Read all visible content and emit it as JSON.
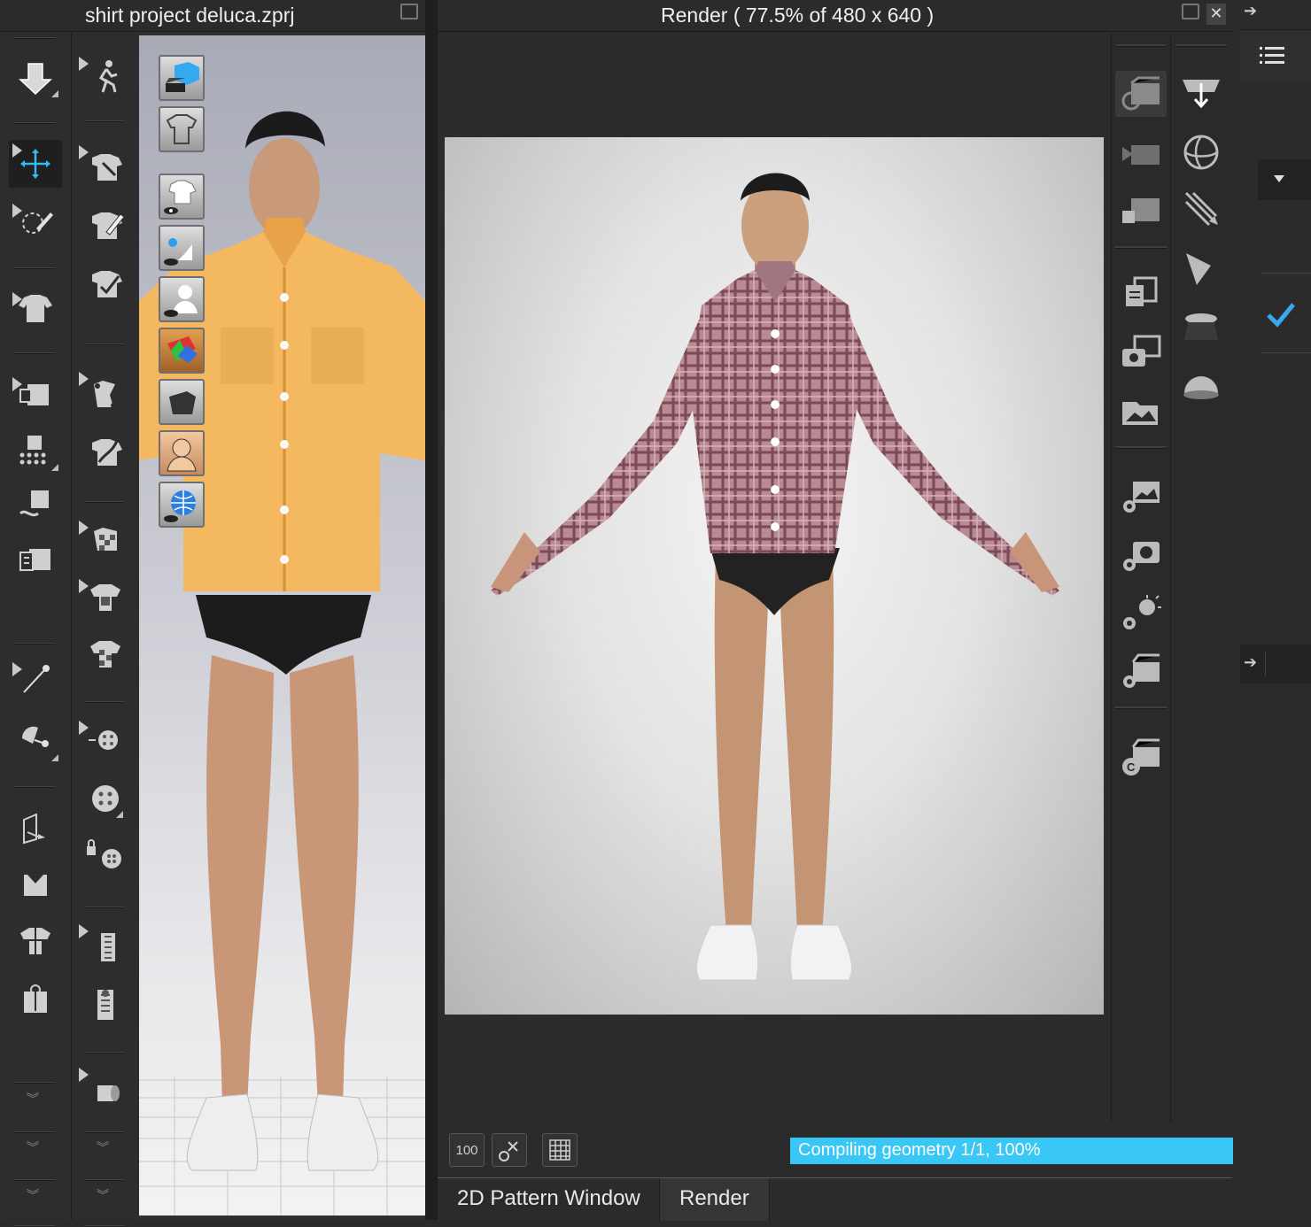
{
  "window3d": {
    "title": "shirt project deluca.zprj",
    "popout_icon": "popout-icon"
  },
  "render": {
    "title": "Render ( 77.5% of 480 x 640 )",
    "zoom_100_label": "100",
    "status_text": "Compiling geometry 1/1, 100%",
    "progress_percent": 100,
    "status_color": "#39c7f7"
  },
  "tabs": [
    {
      "label": "2D Pattern Window",
      "active": false
    },
    {
      "label": "Render",
      "active": true
    }
  ],
  "viewport_toggles": [
    "render-mode-icon",
    "garment-shaded-icon",
    "show-garment-icon",
    "show-trims-icon",
    "show-avatar-icon",
    "texture-icon",
    "solid-icon",
    "avatar-skin-icon",
    "environment-icon"
  ],
  "garment_color_3d": "#f4b860",
  "garment_color_render": "#b98a93"
}
